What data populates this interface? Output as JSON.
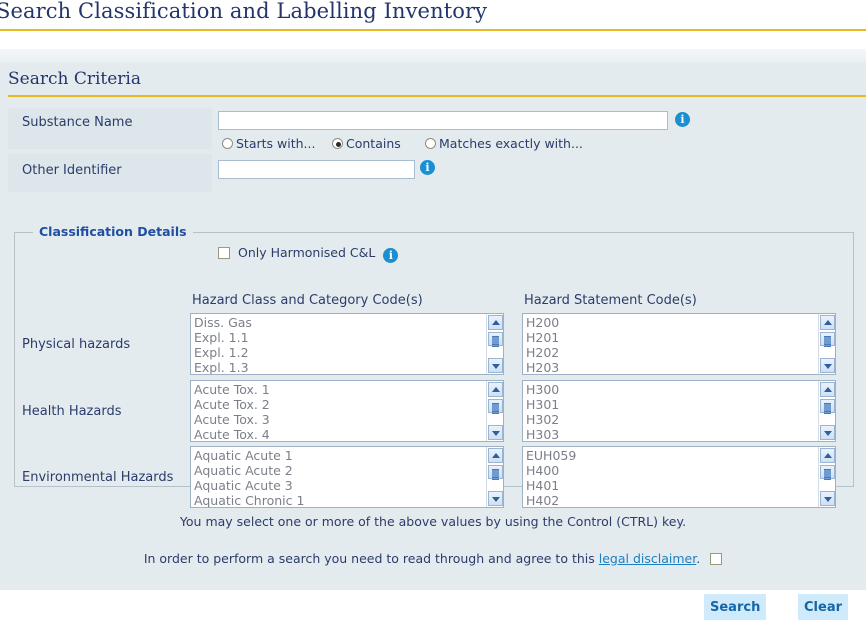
{
  "page": {
    "title": "Search Classification and Labelling Inventory"
  },
  "section": {
    "title": "Search Criteria"
  },
  "fields": {
    "substance_name": {
      "label": "Substance Name",
      "value": "",
      "info_icon": "info-icon"
    },
    "other_identifier": {
      "label": "Other Identifier",
      "value": "",
      "info_icon": "info-icon"
    },
    "match_mode": {
      "selected": "Contains",
      "options": [
        {
          "label": "Starts with...",
          "checked": false
        },
        {
          "label": "Contains",
          "checked": true
        },
        {
          "label": "Matches exactly with...",
          "checked": false
        }
      ]
    },
    "only_harmonised": {
      "label": "Only Harmonised C&L",
      "checked": false,
      "info_icon": "info-icon"
    }
  },
  "classification": {
    "legend": "Classification Details",
    "columns": {
      "hazard_class": "Hazard Class and Category Code(s)",
      "hazard_statement": "Hazard Statement Code(s)"
    },
    "rows": [
      {
        "label": "Physical hazards",
        "hazard_class_options": [
          "Diss. Gas",
          "Expl. 1.1",
          "Expl. 1.2",
          "Expl. 1.3"
        ],
        "hazard_statement_options": [
          "H200",
          "H201",
          "H202",
          "H203"
        ]
      },
      {
        "label": "Health Hazards",
        "hazard_class_options": [
          "Acute Tox. 1",
          "Acute Tox. 2",
          "Acute Tox. 3",
          "Acute Tox. 4"
        ],
        "hazard_statement_options": [
          "H300",
          "H301",
          "H302",
          "H303"
        ]
      },
      {
        "label": "Environmental Hazards",
        "hazard_class_options": [
          "Aquatic Acute 1",
          "Aquatic Acute 2",
          "Aquatic Acute 3",
          "Aquatic Chronic 1"
        ],
        "hazard_statement_options": [
          "EUH059",
          "H400",
          "H401",
          "H402"
        ]
      }
    ],
    "hint": "You may select one or more of the above values by using the Control (CTRL) key."
  },
  "footer": {
    "disclaimer_prefix": "In order to perform a search you need to read through and agree to this ",
    "disclaimer_link": "legal disclaimer",
    "disclaimer_suffix": ".",
    "disclaimer_checked": false,
    "search_label": "Search",
    "clear_label": "Clear"
  },
  "colors": {
    "title_blue": "#23356b",
    "accent_gold": "#e8b923",
    "panel_bg": "#e4ebee",
    "label_cell_bg": "#dde6ea",
    "legend_blue": "#1f4fa0",
    "info_blue": "#1a8fd1",
    "button_bg": "#cfeafa",
    "button_text": "#1566a8",
    "link_blue": "#1b7fc4"
  }
}
